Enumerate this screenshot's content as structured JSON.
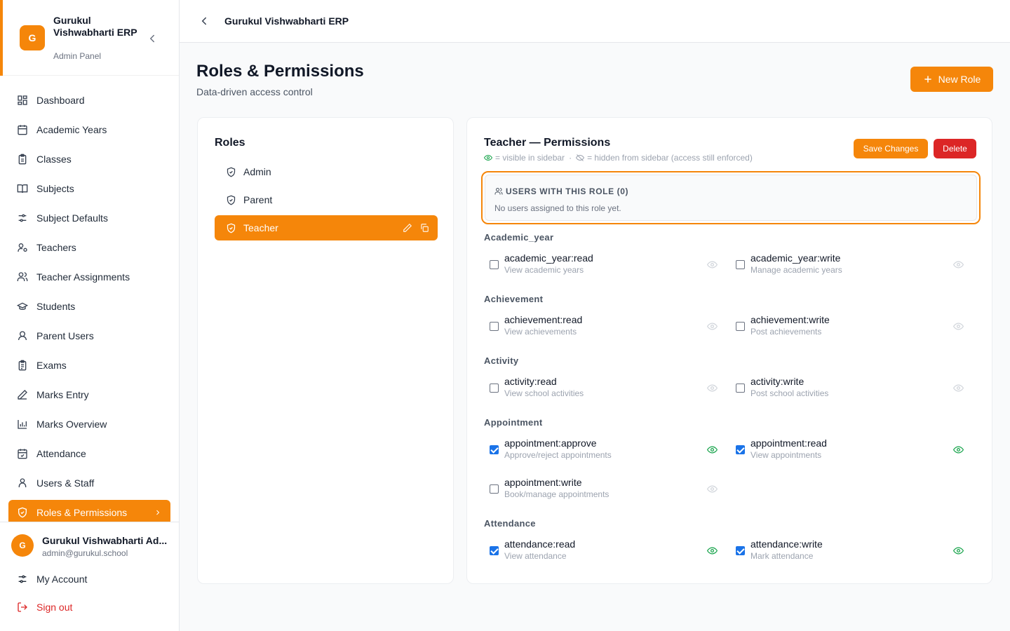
{
  "brand": {
    "logo_letter": "G",
    "name": "Gurukul Vishwabharti ERP",
    "subtitle": "Admin Panel"
  },
  "sidebar": {
    "items": [
      {
        "label": "Dashboard",
        "icon": "grid-icon"
      },
      {
        "label": "Academic Years",
        "icon": "calendar-icon"
      },
      {
        "label": "Classes",
        "icon": "clipboard-icon"
      },
      {
        "label": "Subjects",
        "icon": "book-open-icon"
      },
      {
        "label": "Subject Defaults",
        "icon": "sliders-icon"
      },
      {
        "label": "Teachers",
        "icon": "user-cog-icon"
      },
      {
        "label": "Teacher Assignments",
        "icon": "users-icon"
      },
      {
        "label": "Students",
        "icon": "graduation-cap-icon"
      },
      {
        "label": "Parent Users",
        "icon": "user-round-icon"
      },
      {
        "label": "Exams",
        "icon": "clipboard-list-icon"
      },
      {
        "label": "Marks Entry",
        "icon": "pen-icon"
      },
      {
        "label": "Marks Overview",
        "icon": "bar-chart-icon"
      },
      {
        "label": "Attendance",
        "icon": "calendar-check-icon"
      },
      {
        "label": "Users & Staff",
        "icon": "user-icon"
      },
      {
        "label": "Roles & Permissions",
        "icon": "shield-check-icon",
        "active": true
      }
    ]
  },
  "account": {
    "avatar_letter": "G",
    "name": "Gurukul Vishwabharti Ad...",
    "email": "admin@gurukul.school",
    "my_account_label": "My Account",
    "sign_out_label": "Sign out"
  },
  "topbar": {
    "title": "Gurukul Vishwabharti ERP"
  },
  "page": {
    "title": "Roles & Permissions",
    "subtitle": "Data-driven access control",
    "new_role_label": "New Role"
  },
  "roles": {
    "title": "Roles",
    "items": [
      {
        "label": "Admin"
      },
      {
        "label": "Parent"
      },
      {
        "label": "Teacher",
        "active": true
      }
    ]
  },
  "permissions": {
    "title": "Teacher — Permissions",
    "legend_visible": "= visible in sidebar",
    "legend_hidden": "= hidden from sidebar (access still enforced)",
    "save_label": "Save Changes",
    "delete_label": "Delete",
    "users_heading": "USERS WITH THIS ROLE (0)",
    "users_empty": "No users assigned to this role yet.",
    "colors": {
      "accent": "#f5860a",
      "danger": "#dc2626",
      "checked": "#1a73e8",
      "visible": "#16a34a"
    },
    "groups": [
      {
        "label": "Academic_year",
        "perms": [
          {
            "name": "academic_year:read",
            "desc": "View academic years",
            "checked": false,
            "visible": false
          },
          {
            "name": "academic_year:write",
            "desc": "Manage academic years",
            "checked": false,
            "visible": false
          }
        ]
      },
      {
        "label": "Achievement",
        "perms": [
          {
            "name": "achievement:read",
            "desc": "View achievements",
            "checked": false,
            "visible": false
          },
          {
            "name": "achievement:write",
            "desc": "Post achievements",
            "checked": false,
            "visible": false
          }
        ]
      },
      {
        "label": "Activity",
        "perms": [
          {
            "name": "activity:read",
            "desc": "View school activities",
            "checked": false,
            "visible": false
          },
          {
            "name": "activity:write",
            "desc": "Post school activities",
            "checked": false,
            "visible": false
          }
        ]
      },
      {
        "label": "Appointment",
        "perms": [
          {
            "name": "appointment:approve",
            "desc": "Approve/reject appointments",
            "checked": true,
            "visible": true
          },
          {
            "name": "appointment:read",
            "desc": "View appointments",
            "checked": true,
            "visible": true
          },
          {
            "name": "appointment:write",
            "desc": "Book/manage appointments",
            "checked": false,
            "visible": false
          }
        ]
      },
      {
        "label": "Attendance",
        "perms": [
          {
            "name": "attendance:read",
            "desc": "View attendance",
            "checked": true,
            "visible": true
          },
          {
            "name": "attendance:write",
            "desc": "Mark attendance",
            "checked": true,
            "visible": true
          }
        ]
      }
    ]
  }
}
